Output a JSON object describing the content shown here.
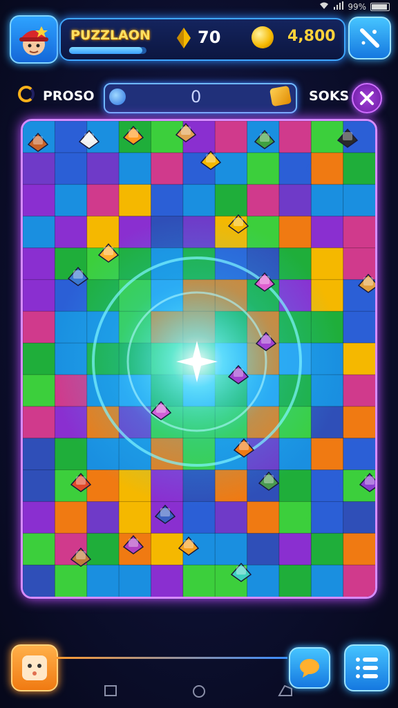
{
  "status_bar": {
    "battery": "99%"
  },
  "header": {
    "title": "PUZZLAON",
    "gems": "70",
    "coins": "4,800",
    "title_progress": 0.95
  },
  "toolbar": {
    "progress_label": "PROSO",
    "search_value": "0",
    "right_label": "SOKS"
  },
  "icons": {
    "avatar": "avatar-icon",
    "gem": "gem-icon",
    "coin": "coin-icon",
    "menu": "wand-icon",
    "progress": "ring-icon",
    "close": "close-icon",
    "face": "face-icon",
    "chat": "chat-icon",
    "list": "list-icon"
  },
  "colors": {
    "accent": "#3fa7ff",
    "board_border": "#d68cff",
    "title": "#ffe061",
    "coin": "#ffd23a"
  }
}
